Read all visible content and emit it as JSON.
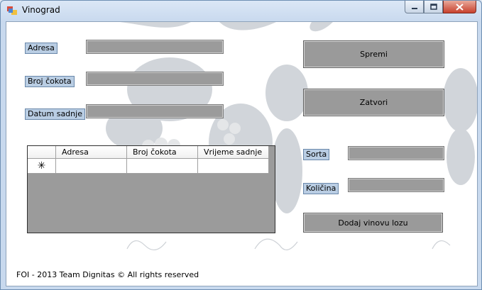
{
  "window": {
    "title": "Vinograd",
    "icons": {
      "app": "form-app-icon",
      "minimize": "minimize-icon",
      "maximize": "maximize-icon",
      "close": "close-icon"
    }
  },
  "form": {
    "address_label": "Adresa",
    "vine_count_label": "Broj čokota",
    "planting_date_label": "Datum sadnje",
    "variety_label": "Sorta",
    "quantity_label": "Količina",
    "address_value": "",
    "vine_count_value": "",
    "planting_date_value": "",
    "variety_value": "",
    "quantity_value": ""
  },
  "buttons": {
    "save": "Spremi",
    "close": "Zatvori",
    "add_vine": "Dodaj vinovu lozu"
  },
  "grid": {
    "columns": [
      "Adresa",
      "Broj čokota",
      "Vrijeme sadnje"
    ],
    "new_row_marker": "✳",
    "rows": []
  },
  "footer": "FOI - 2013 Team Dignitas  © All rights reserved",
  "background_watermark": "grape-vine-watermark"
}
